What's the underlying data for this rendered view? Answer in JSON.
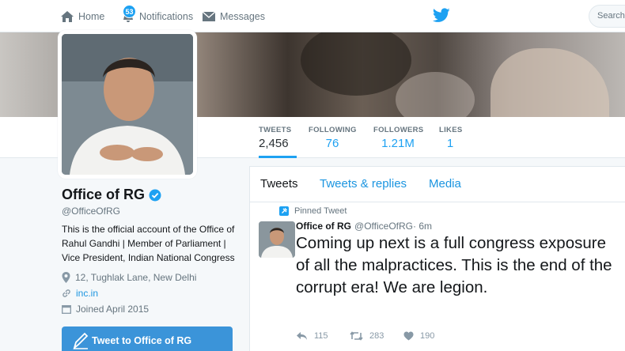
{
  "nav": {
    "home_label": "Home",
    "notifications_label": "Notifications",
    "notifications_count": "53",
    "messages_label": "Messages",
    "search_placeholder": "Search"
  },
  "stats": [
    {
      "label": "TWEETS",
      "value": "2,456"
    },
    {
      "label": "FOLLOWING",
      "value": "76"
    },
    {
      "label": "FOLLOWERS",
      "value": "1.21M"
    },
    {
      "label": "LIKES",
      "value": "1"
    }
  ],
  "profile": {
    "name": "Office of RG",
    "handle": "@OfficeOfRG",
    "bio": "This is the official account of the Office of Rahul Gandhi | Member of Parliament | Vice President, Indian National Congress",
    "location": "12, Tughlak Lane, New Delhi",
    "website": "inc.in",
    "joined": "Joined April 2015",
    "tweet_to_label": "Tweet to Office of RG"
  },
  "timeline": {
    "tabs": [
      "Tweets",
      "Tweets & replies",
      "Media"
    ],
    "pinned_label": "Pinned Tweet",
    "tweet": {
      "name": "Office of RG",
      "handle": "@OfficeOfRG",
      "time": "· 6m",
      "text": "Coming up next is a full congress exposure of all the malpractices. This is the end of the corrupt era! We are legion.",
      "replies": "115",
      "retweets": "283",
      "likes": "190"
    }
  },
  "colors": {
    "accent": "#1da1f2",
    "link": "#1b95e0",
    "button": "#3b94d9"
  }
}
